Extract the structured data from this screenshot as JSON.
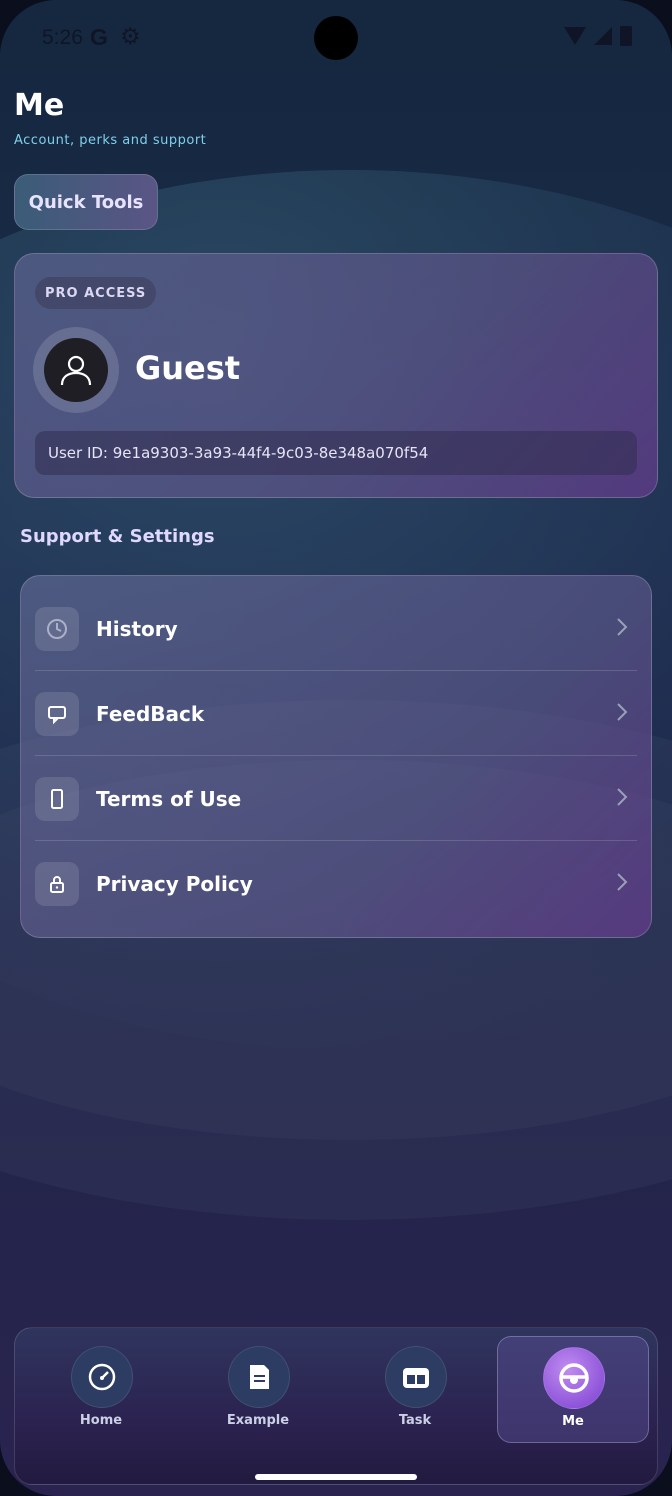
{
  "status_bar": {
    "time": "5:26",
    "google": "G"
  },
  "header": {
    "title": "Me",
    "subtitle": "Account, perks and support"
  },
  "quick_tools": {
    "label": "Quick Tools"
  },
  "profile": {
    "badge": "PRO ACCESS",
    "name": "Guest",
    "user_id": "User ID: 9e1a9303-3a93-44f4-9c03-8e348a070f54"
  },
  "support": {
    "title": "Support & Settings",
    "items": [
      {
        "label": "History",
        "icon": "history-icon"
      },
      {
        "label": "FeedBack",
        "icon": "feedback-icon"
      },
      {
        "label": "Terms of Use",
        "icon": "document-icon"
      },
      {
        "label": "Privacy Policy",
        "icon": "lock-icon"
      }
    ]
  },
  "nav": {
    "tabs": [
      {
        "label": "Home",
        "icon": "gauge-icon"
      },
      {
        "label": "Example",
        "icon": "document-icon"
      },
      {
        "label": "Task",
        "icon": "task-icon"
      },
      {
        "label": "Me",
        "icon": "steering-wheel-icon",
        "active": true
      }
    ]
  },
  "colors": {
    "accent": "#7fd0ea",
    "active": "#9a5ee0"
  }
}
